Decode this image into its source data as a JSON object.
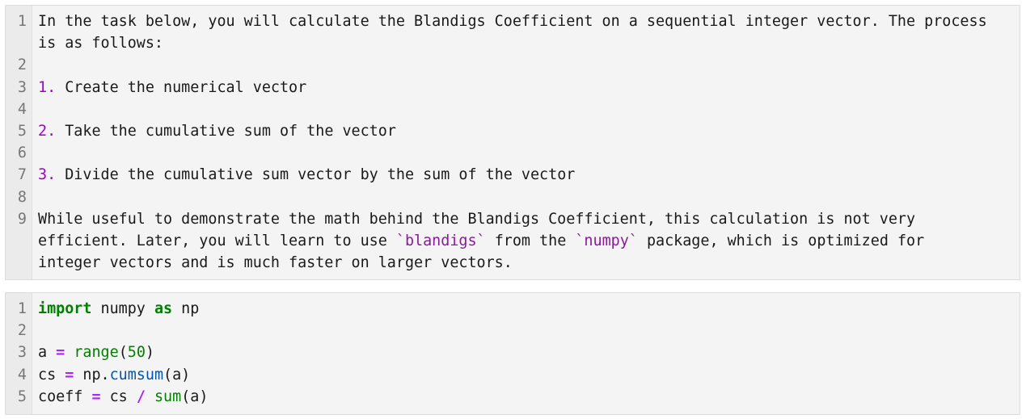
{
  "markdown_cell": {
    "lines": [
      {
        "n": "1",
        "parts": [
          {
            "t": "text",
            "v": "In the task below, you will calculate the Blandigs Coefficient on a sequential integer vector. The process is as follows:"
          }
        ]
      },
      {
        "n": "2",
        "parts": []
      },
      {
        "n": "3",
        "parts": [
          {
            "t": "md-num",
            "v": "1."
          },
          {
            "t": "text",
            "v": " Create the numerical vector"
          }
        ]
      },
      {
        "n": "4",
        "parts": []
      },
      {
        "n": "5",
        "parts": [
          {
            "t": "md-num",
            "v": "2."
          },
          {
            "t": "text",
            "v": " Take the cumulative sum of the vector"
          }
        ]
      },
      {
        "n": "6",
        "parts": []
      },
      {
        "n": "7",
        "parts": [
          {
            "t": "md-num",
            "v": "3."
          },
          {
            "t": "text",
            "v": " Divide the cumulative sum vector by the sum of the vector"
          }
        ]
      },
      {
        "n": "8",
        "parts": []
      },
      {
        "n": "9",
        "parts": [
          {
            "t": "text",
            "v": "While useful to demonstrate the math behind the Blandigs Coefficient, this calculation is not very efficient. Later, you will learn to use "
          },
          {
            "t": "md-code",
            "v": "`blandigs`"
          },
          {
            "t": "text",
            "v": " from the "
          },
          {
            "t": "md-code",
            "v": "`numpy`"
          },
          {
            "t": "text",
            "v": " package, which is optimized for integer vectors and is much faster on larger vectors."
          }
        ]
      }
    ]
  },
  "code_cell": {
    "lines": [
      {
        "n": "1",
        "parts": [
          {
            "t": "kw",
            "v": "import"
          },
          {
            "t": "text",
            "v": " numpy "
          },
          {
            "t": "kw",
            "v": "as"
          },
          {
            "t": "text",
            "v": " np"
          }
        ]
      },
      {
        "n": "2",
        "parts": []
      },
      {
        "n": "3",
        "parts": [
          {
            "t": "text",
            "v": "a "
          },
          {
            "t": "op",
            "v": "="
          },
          {
            "t": "text",
            "v": " "
          },
          {
            "t": "bi",
            "v": "range"
          },
          {
            "t": "text",
            "v": "("
          },
          {
            "t": "num",
            "v": "50"
          },
          {
            "t": "text",
            "v": ")"
          }
        ]
      },
      {
        "n": "4",
        "parts": [
          {
            "t": "text",
            "v": "cs "
          },
          {
            "t": "op",
            "v": "="
          },
          {
            "t": "text",
            "v": " np."
          },
          {
            "t": "attr",
            "v": "cumsum"
          },
          {
            "t": "text",
            "v": "(a)"
          }
        ]
      },
      {
        "n": "5",
        "parts": [
          {
            "t": "text",
            "v": "coeff "
          },
          {
            "t": "op",
            "v": "="
          },
          {
            "t": "text",
            "v": " cs "
          },
          {
            "t": "op",
            "v": "/"
          },
          {
            "t": "text",
            "v": " "
          },
          {
            "t": "bi",
            "v": "sum"
          },
          {
            "t": "text",
            "v": "(a)"
          }
        ]
      }
    ]
  }
}
